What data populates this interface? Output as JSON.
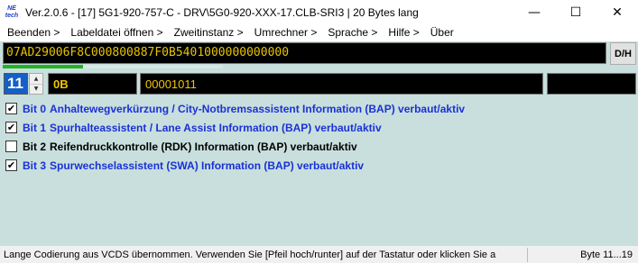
{
  "window": {
    "icon_text": [
      "NE",
      "tech"
    ],
    "title": "Ver.2.0.6 - [17] 5G1-920-757-C - DRV\\5G0-920-XXX-17.CLB-SRI3 | 20 Bytes lang",
    "minimize": "—",
    "maximize": "☐",
    "close": "✕"
  },
  "menu": [
    "Beenden >",
    "Labeldatei öffnen >",
    "Zweitinstanz >",
    "Umrechner >",
    "Sprache >",
    "Hilfe >",
    "Über"
  ],
  "coding": {
    "value": "07AD29006F8C000800887F0B5401000000000000",
    "dh_label": "D/H",
    "progress": 0.365
  },
  "byte": {
    "number": "11",
    "hex": "0B",
    "binary": "00001011",
    "extra": ""
  },
  "bits": [
    {
      "label": "Bit 0",
      "text": "Anhaltewegverkürzung / City-Notbremsassistent Information (BAP) verbaut/aktiv",
      "checked": true
    },
    {
      "label": "Bit 1",
      "text": "Spurhalteassistent / Lane Assist Information (BAP) verbaut/aktiv",
      "checked": true
    },
    {
      "label": "Bit 2",
      "text": "Reifendruckkontrolle (RDK) Information (BAP) verbaut/aktiv",
      "checked": false
    },
    {
      "label": "Bit 3",
      "text": "Spurwechselassistent (SWA) Information (BAP) verbaut/aktiv",
      "checked": true
    }
  ],
  "statusbar": {
    "message": "Lange Codierung aus VCDS übernommen. Verwenden Sie [Pfeil hoch/runter] auf der Tastatur oder klicken Sie a",
    "bytes": "Byte 11...19"
  },
  "colors": {
    "background": "#c8dfdd",
    "field_text": "#f2c500",
    "active_bit": "#1a31d6",
    "progress": "#21b521"
  }
}
